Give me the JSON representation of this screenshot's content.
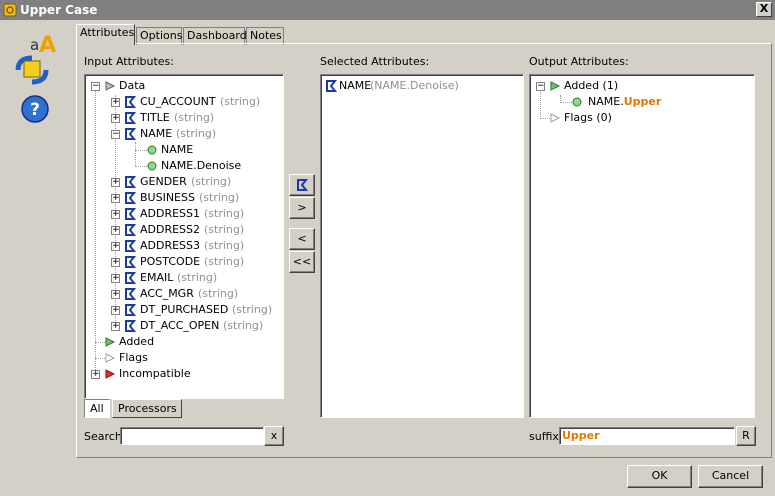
{
  "window": {
    "title": "Upper Case",
    "close_label": "X"
  },
  "tabs": [
    "Attributes",
    "Options",
    "Dashboard",
    "Notes"
  ],
  "input_panel": {
    "label": "Input Attributes:",
    "root": "Data",
    "attributes": [
      {
        "name": "CU_ACCOUNT",
        "type": "(string)"
      },
      {
        "name": "TITLE",
        "type": "(string)"
      },
      {
        "name": "NAME",
        "type": "(string)"
      },
      {
        "name": "GENDER",
        "type": "(string)"
      },
      {
        "name": "BUSINESS",
        "type": "(string)"
      },
      {
        "name": "ADDRESS1",
        "type": "(string)"
      },
      {
        "name": "ADDRESS2",
        "type": "(string)"
      },
      {
        "name": "ADDRESS3",
        "type": "(string)"
      },
      {
        "name": "POSTCODE",
        "type": "(string)"
      },
      {
        "name": "EMAIL",
        "type": "(string)"
      },
      {
        "name": "ACC_MGR",
        "type": "(string)"
      },
      {
        "name": "DT_PURCHASED",
        "type": "(string)"
      },
      {
        "name": "DT_ACC_OPEN",
        "type": "(string)"
      }
    ],
    "name_children": [
      "NAME",
      "NAME.Denoise"
    ],
    "groups": [
      "Added",
      "Flags",
      "Incompatible"
    ],
    "subtabs": [
      "All",
      "Processors"
    ]
  },
  "search": {
    "label": "Search",
    "value": "",
    "clear_label": "x"
  },
  "move_buttons": {
    "add_selected": "",
    "add": ">",
    "remove": "<",
    "remove_all": "<<"
  },
  "selected_panel": {
    "label": "Selected Attributes:",
    "items": [
      {
        "name": "NAME",
        "source": "(NAME.Denoise)"
      }
    ]
  },
  "output_panel": {
    "label": "Output Attributes:",
    "added": "Added (1)",
    "output_name_prefix": "NAME.",
    "output_name_suffix": "Upper",
    "flags": "Flags (0)"
  },
  "suffix": {
    "label": "suffix",
    "value": "Upper",
    "reset_label": "R"
  },
  "footer": {
    "ok_label": "OK",
    "cancel_label": "Cancel"
  },
  "colors": {
    "accent": "#e07800",
    "attr_icon": "#1a3aa8",
    "added_green": "#3a9a3a",
    "incompatible_red": "#d02020"
  }
}
